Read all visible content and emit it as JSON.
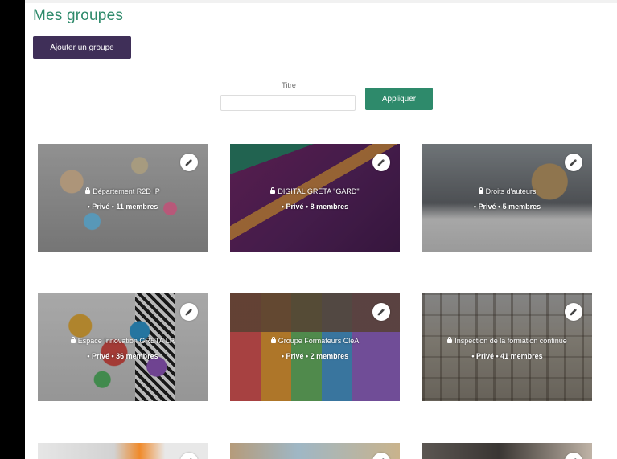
{
  "page": {
    "title": "Mes groupes",
    "add_group_label": "Ajouter un groupe"
  },
  "filter": {
    "label": "Titre",
    "value": "",
    "apply_label": "Appliquer"
  },
  "groups": [
    {
      "name": "Département R2D IP",
      "meta": "• Privé • 11 membres",
      "image_theme": "sticky-notes-meeting",
      "icons": [
        "lock-icon",
        "pencil-icon"
      ]
    },
    {
      "name": "DIGITAL GRETA \"GARD\"",
      "meta": "• Privé • 8 membres",
      "image_theme": "purple-abstract-banner",
      "icons": [
        "lock-icon",
        "pencil-icon"
      ]
    },
    {
      "name": "Droits d'auteurs",
      "meta": "• Privé • 5 membres",
      "image_theme": "person-writing-notebook",
      "icons": [
        "lock-icon",
        "pencil-icon"
      ]
    },
    {
      "name": "Espace Innovation GRETA LR",
      "meta": "• Privé • 36 membres",
      "image_theme": "colorful-polygons",
      "icons": [
        "lock-icon",
        "pencil-icon"
      ]
    },
    {
      "name": "Groupe Formateurs CléA",
      "meta": "• Privé • 2 membres",
      "image_theme": "savoirs-de-base",
      "icons": [
        "lock-icon",
        "pencil-icon"
      ]
    },
    {
      "name": "Inspection de la formation continue",
      "meta": "• Privé • 41 membres",
      "image_theme": "building-facade",
      "icons": [
        "lock-icon",
        "pencil-icon"
      ]
    },
    {
      "name": "",
      "meta": "",
      "image_theme": "partial-card",
      "icons": [
        "pencil-icon"
      ]
    },
    {
      "name": "",
      "meta": "",
      "image_theme": "partial-card",
      "icons": [
        "pencil-icon"
      ]
    },
    {
      "name": "",
      "meta": "",
      "image_theme": "partial-card",
      "icons": [
        "pencil-icon"
      ]
    }
  ],
  "colors": {
    "accent": "#2e8a6b",
    "primary_button": "#3f2f58"
  }
}
